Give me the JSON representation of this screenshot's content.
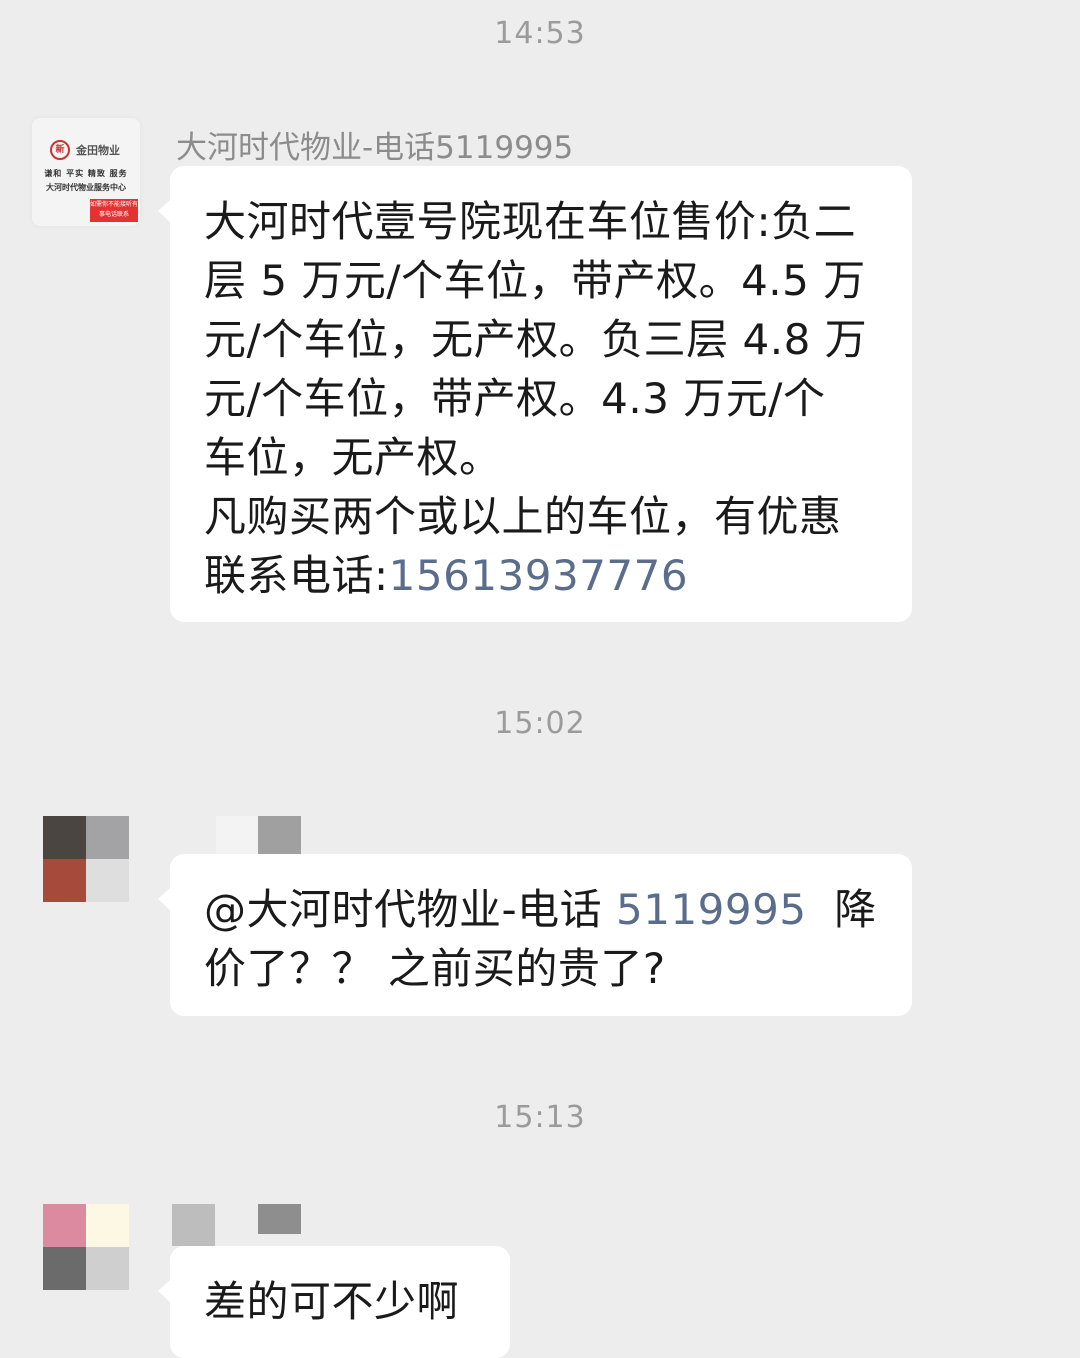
{
  "messages": [
    {
      "time": "14:53",
      "sender": "大河时代物业-电话5119995",
      "avatar": {
        "logo_name": "金田物业",
        "slogan": "谦和 平实 精致 服务",
        "center": "大河时代物业服务中心",
        "red_tag": "如需你不能接听有事电话联系"
      },
      "lines": [
        "大河时代壹号院现在车位售价:负二",
        "层 5 万元/个车位，带产权。4.5 万",
        "元/个车位，无产权。负三层 4.8 万",
        "元/个车位，带产权。4.3 万元/个",
        "车位，无产权。",
        "凡购买两个或以上的车位，有优惠"
      ],
      "phone_label": "联系电话:",
      "phone_number": "15613937776"
    },
    {
      "time": "15:02",
      "mention_prefix": "@大河时代物业-电话 ",
      "mention_number": "5119995",
      "line1_suffix": "  降",
      "line2": "价了？？ 之前买的贵了?"
    },
    {
      "time": "15:13",
      "text": "差的可不少啊"
    }
  ],
  "colors": {
    "background": "#ededed",
    "bubble": "#ffffff",
    "link": "#5a6d8c",
    "timestamp": "#9b9b9b"
  }
}
